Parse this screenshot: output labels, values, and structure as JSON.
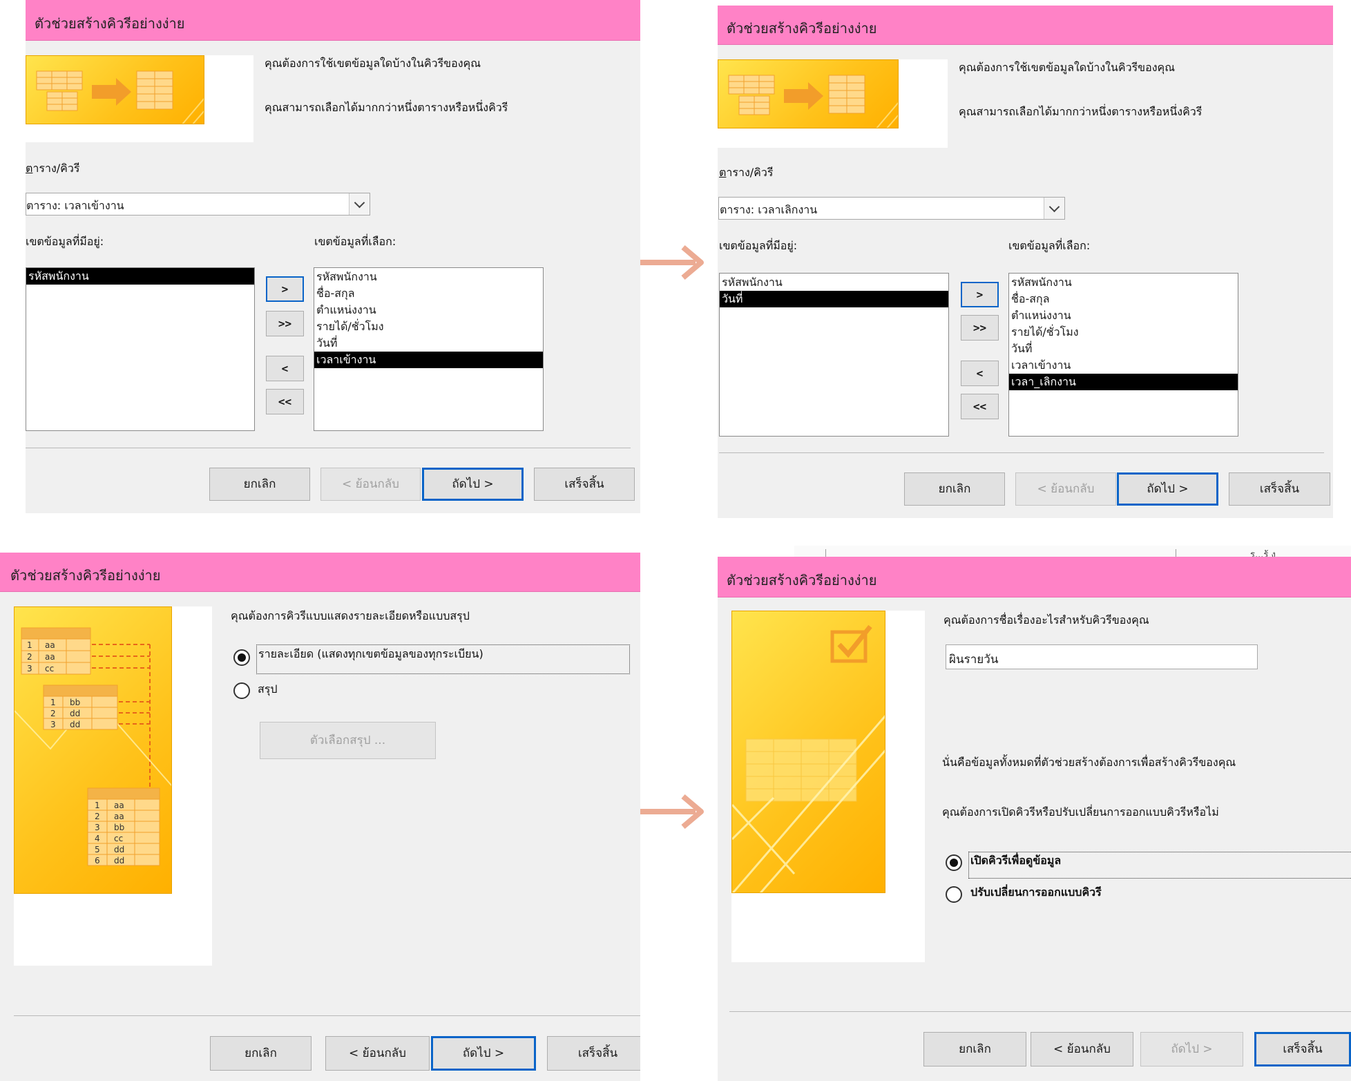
{
  "colors": {
    "title_bar": "#ff82c6",
    "arrow": "#ecab93",
    "selection": "#000000",
    "focus_border": "#0a64c8"
  },
  "wizard_title": "ตัวช่วยสร้างคิวรีอย่างง่าย",
  "buttons": {
    "cancel": "ยกเลิก",
    "back": "< ย้อนกลับ",
    "next": "ถัดไป >",
    "finish": "เสร็จสิ้น"
  },
  "step1": {
    "prompt": "คุณต้องการใช้เขตข้อมูลใดบ้างในคิวรีของคุณ",
    "hint": "คุณสามารถเลือกได้มากกว่าหนึ่งตารางหรือหนึ่งคิวรี",
    "table_label": "ตาราง/คิวรี",
    "available_label": "เขตข้อมูลที่มีอยู่:",
    "selected_label": "เขตข้อมูลที่เลือก:",
    "move_buttons": [
      ">",
      ">>",
      "<",
      "<<"
    ]
  },
  "screen1": {
    "table_value": "ตาราง: เวลาเข้างาน",
    "available": [
      "รหัสพนักงาน"
    ],
    "selected": [
      "รหัสพนักงาน",
      "ชื่อ-สกุล",
      "ตำแหน่งงาน",
      "รายได้/ชั่วโมง",
      "วันที่",
      "เวลาเข้างาน"
    ]
  },
  "screen2": {
    "table_value": "ตาราง: เวลาเลิกงาน",
    "available": [
      "รหัสพนักงาน",
      "วันที่"
    ],
    "selected": [
      "รหัสพนักงาน",
      "ชื่อ-สกุล",
      "ตำแหน่งงาน",
      "รายได้/ชั่วโมง",
      "วันที่",
      "เวลาเข้างาน",
      "เวลา_เลิกงาน"
    ]
  },
  "screen3": {
    "prompt": "คุณต้องการคิวรีแบบแสดงรายละเอียดหรือแบบสรุป",
    "option_detail": "รายละเอียด (แสดงทุกเขตข้อมูลของทุกระเบียน)",
    "option_summary": "สรุป",
    "summary_options_button": "ตัวเลือกสรุป ...",
    "illustration_rows": [
      [
        "1",
        "aa"
      ],
      [
        "2",
        "aa"
      ],
      [
        "3",
        "cc"
      ],
      [
        "1",
        "bb"
      ],
      [
        "2",
        "dd"
      ],
      [
        "3",
        "dd"
      ],
      [
        "1",
        "aa"
      ],
      [
        "2",
        "aa"
      ],
      [
        "3",
        "bb"
      ],
      [
        "4",
        "cc"
      ],
      [
        "5",
        "dd"
      ],
      [
        "6",
        "dd"
      ]
    ]
  },
  "screen4": {
    "prompt": "คุณต้องการชื่อเรื่องอะไรสำหรับคิวรีของคุณ",
    "title_value": "ผินรายวัน",
    "info": "นั่นคือข้อมูลทั้งหมดที่ตัวช่วยสร้างต้องการเพื่อสร้างคิวรีของคุณ",
    "question": "คุณต้องการเปิดคิวรีหรือปรับเปลี่ยนการออกแบบคิวรีหรือไม่",
    "option_open": "เปิดคิวรีเพื่อดูข้อมูล",
    "option_modify": "ปรับเปลี่ยนการออกแบบคิวรี"
  },
  "background_glyphs": "ร...ร้ ง"
}
